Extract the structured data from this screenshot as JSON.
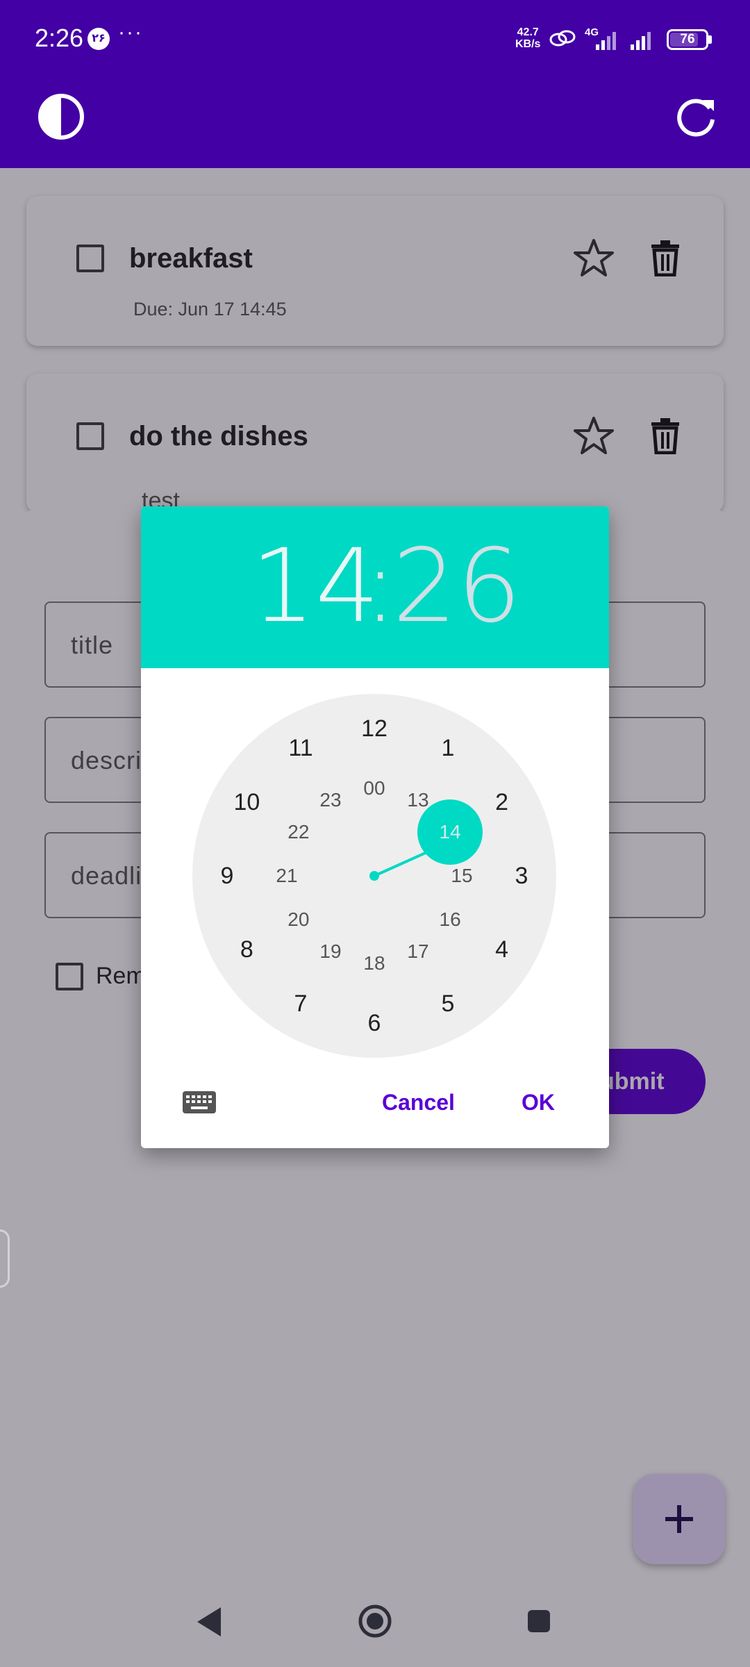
{
  "status_bar": {
    "time": "2:26",
    "badge": "۲۶",
    "dots": "···",
    "speed_value": "42.7",
    "speed_unit": "KB/s",
    "network": "4G",
    "battery": "76"
  },
  "app_bar": {
    "theme_icon": "theme-toggle-icon",
    "refresh_icon": "refresh-icon"
  },
  "tasks": [
    {
      "title": "breakfast",
      "subtitle": "Due: Jun 17 14:45"
    },
    {
      "title": "do the dishes",
      "subtitle": "test"
    }
  ],
  "form": {
    "title_placeholder": "title",
    "description_placeholder": "descri",
    "deadline_placeholder": "deadli",
    "reminder_label": "Rem",
    "submit_label": "ubmit"
  },
  "time_picker": {
    "hour": "14",
    "colon": ":",
    "minute": "26",
    "outer_numbers": [
      "12",
      "1",
      "2",
      "3",
      "4",
      "5",
      "6",
      "7",
      "8",
      "9",
      "10",
      "11"
    ],
    "inner_numbers": [
      "00",
      "13",
      "14",
      "15",
      "16",
      "17",
      "18",
      "19",
      "20",
      "21",
      "22",
      "23"
    ],
    "selected_hour": "14",
    "cancel_label": "Cancel",
    "ok_label": "OK",
    "accent_color": "#00d9c4",
    "button_color": "#5a00d6"
  },
  "colors": {
    "app_bar": "#4300a5",
    "fab_bg": "#e9ddff"
  }
}
